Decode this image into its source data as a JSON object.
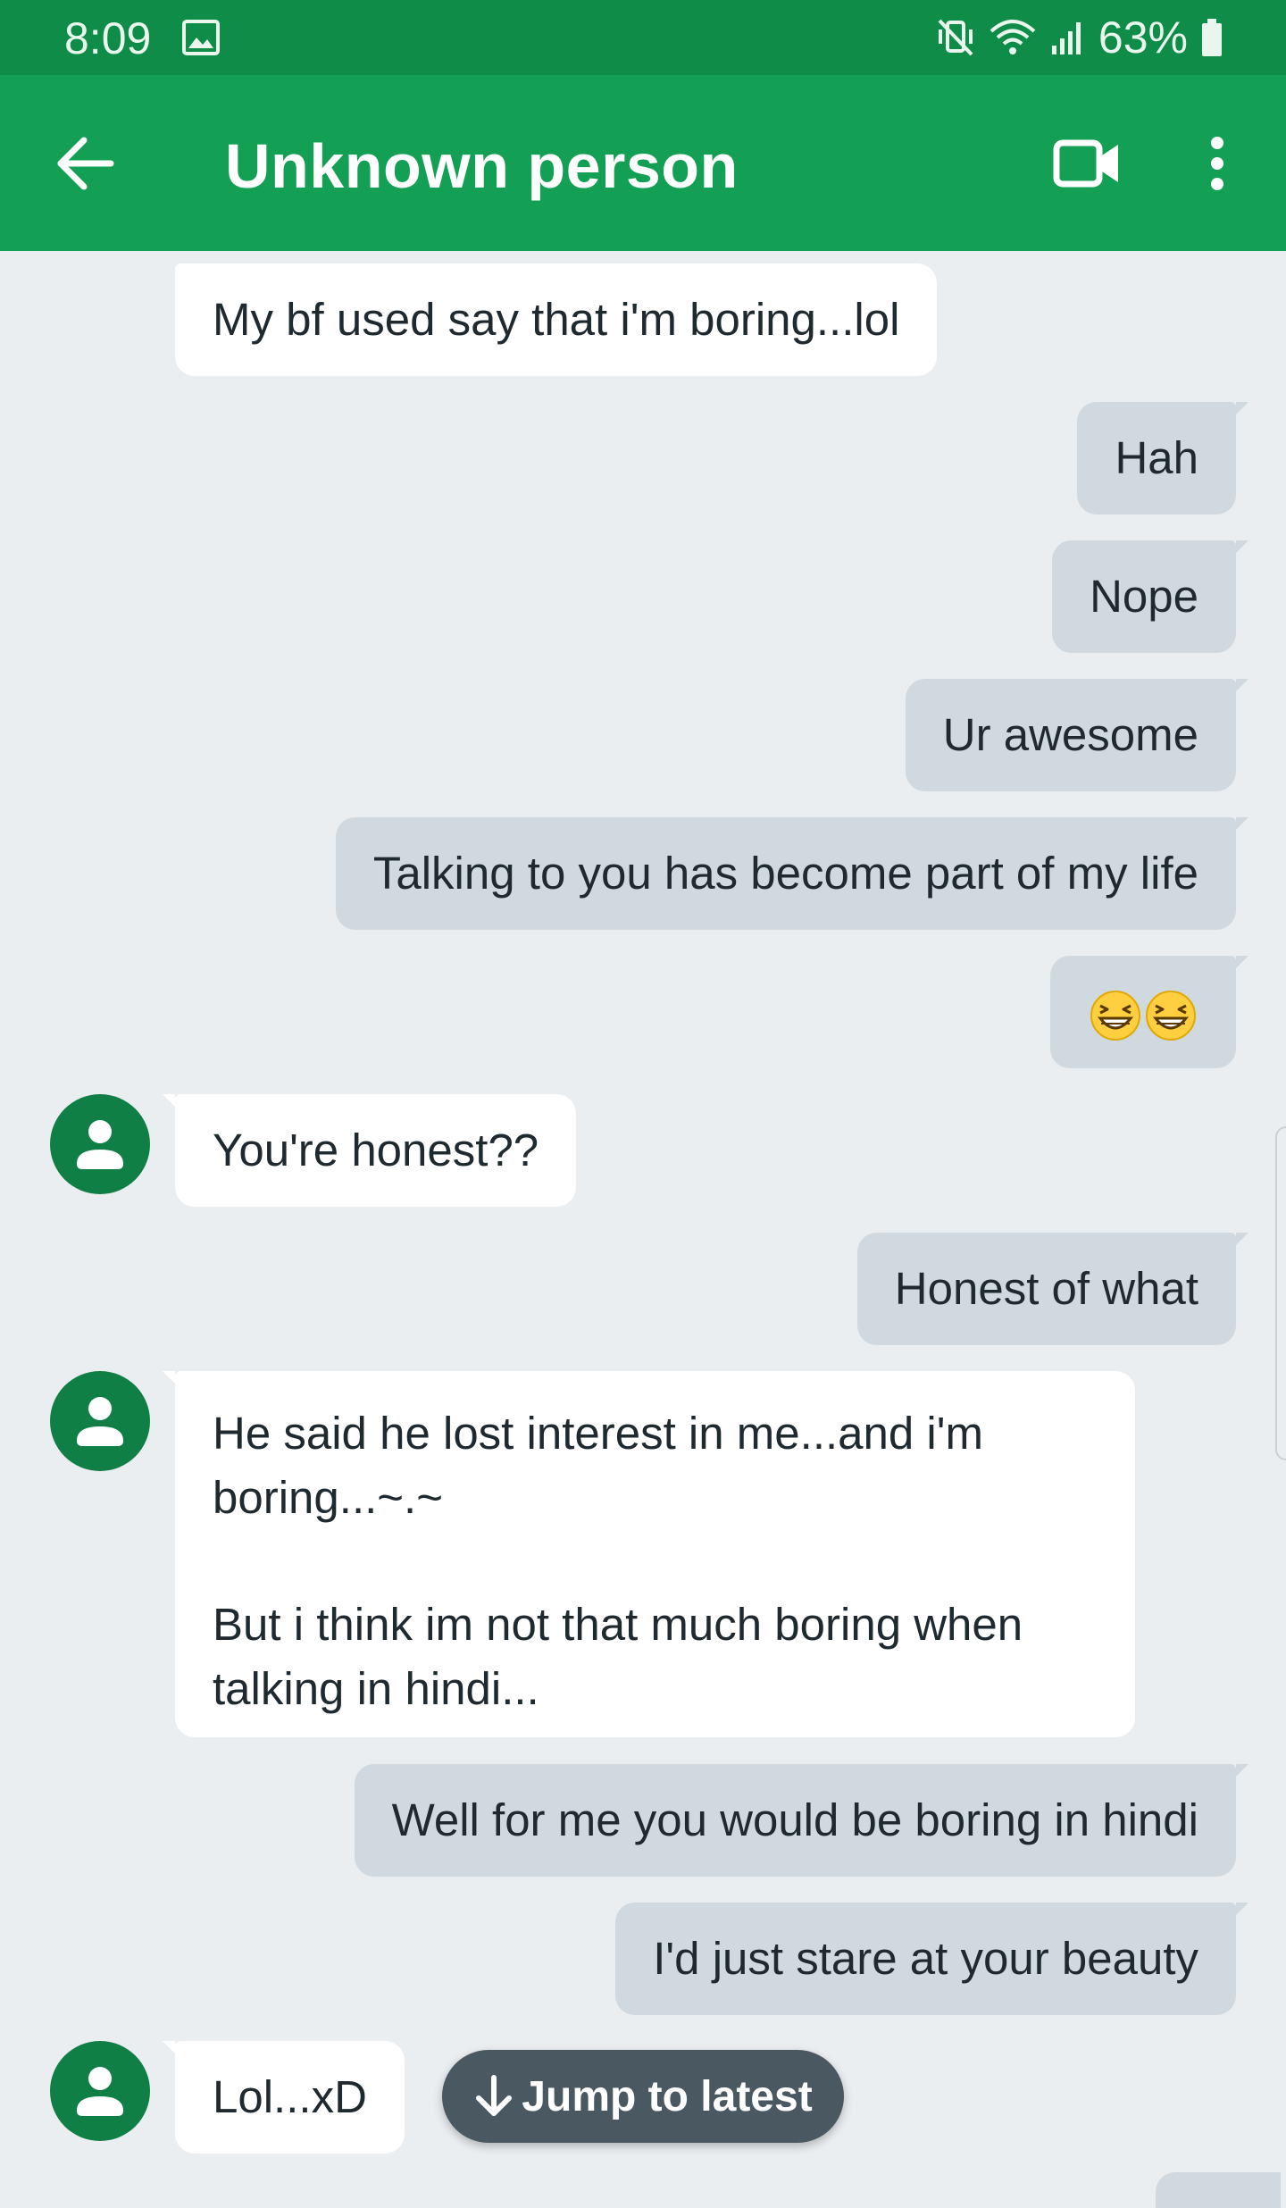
{
  "status_bar": {
    "time": "8:09",
    "battery_percent": "63%",
    "icons": [
      "gallery-icon",
      "vibrate-mute-icon",
      "wifi-icon",
      "signal-icon",
      "battery-icon"
    ],
    "background": "#0f8c47"
  },
  "app_bar": {
    "title": "Unknown person",
    "icons": [
      "back-arrow-icon",
      "video-call-icon",
      "more-vert-icon"
    ],
    "background": "#14a054"
  },
  "messages": [
    {
      "direction": "incoming",
      "text": "My bf used say that i'm boring...lol"
    },
    {
      "direction": "outgoing",
      "text": "Hah"
    },
    {
      "direction": "outgoing",
      "text": "Nope"
    },
    {
      "direction": "outgoing",
      "text": "Ur awesome"
    },
    {
      "direction": "outgoing",
      "text": "Talking to you has become part of my life"
    },
    {
      "direction": "outgoing",
      "text": "",
      "emoji": [
        "grinning-squinting-face",
        "grinning-squinting-face"
      ]
    },
    {
      "direction": "incoming",
      "text": "You're honest??"
    },
    {
      "direction": "outgoing",
      "text": "Honest of what"
    },
    {
      "direction": "incoming",
      "paragraphs": [
        "He said he lost interest in me...and i'm boring...~.~",
        "But i think im not that much boring when talking in hindi..."
      ]
    },
    {
      "direction": "outgoing",
      "text": "Well for me you would be boring in hindi"
    },
    {
      "direction": "outgoing",
      "text": "I'd just stare at your beauty"
    },
    {
      "direction": "incoming",
      "text": "Lol...xD"
    }
  ],
  "jump_to_latest": {
    "label": "Jump to latest",
    "icon": "arrow-down-icon"
  },
  "colors": {
    "incoming_bubble": "#ffffff",
    "outgoing_bubble": "#d0d9df",
    "avatar": "#0f7f45",
    "thread_background": "#eaeef1"
  }
}
